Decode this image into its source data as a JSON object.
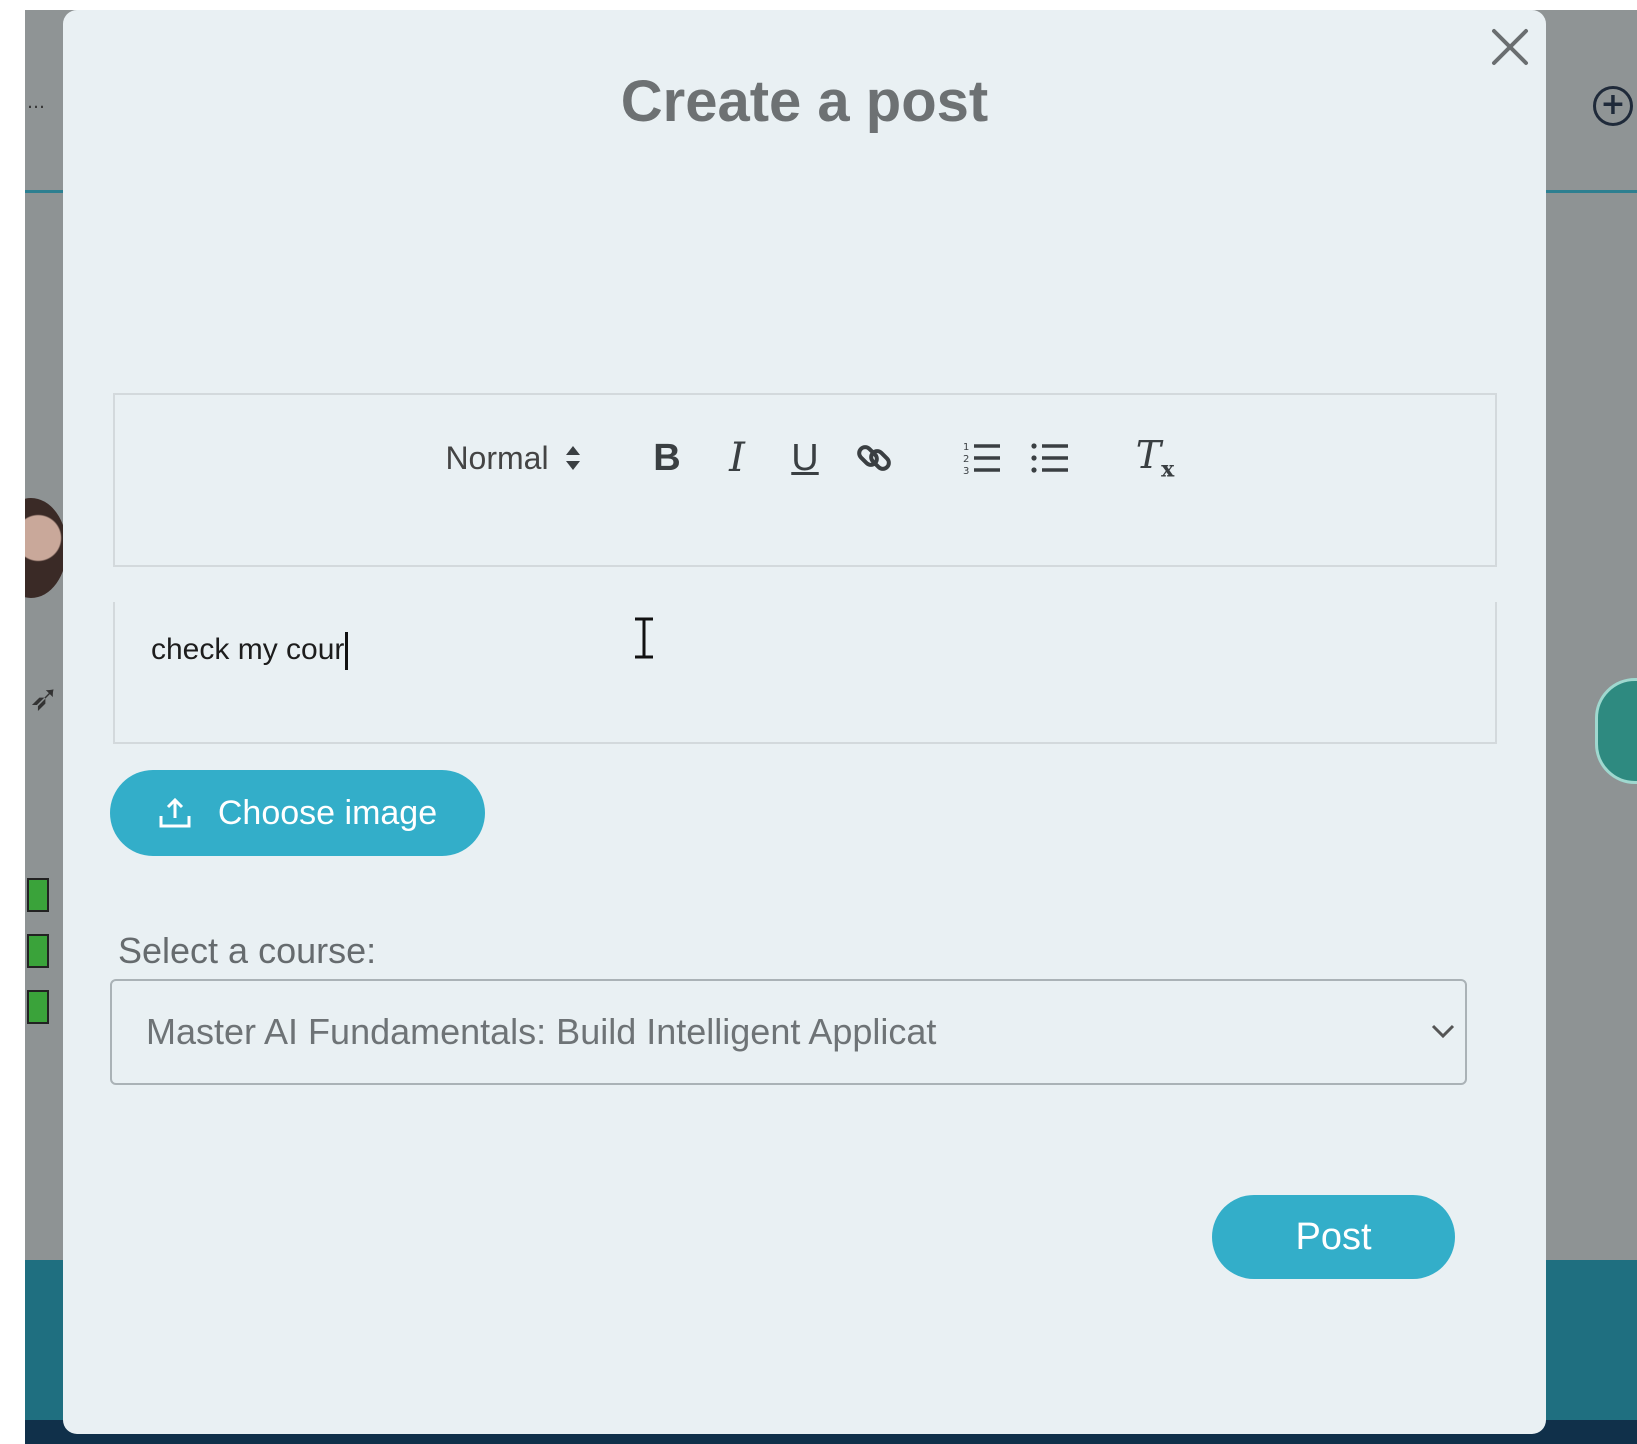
{
  "modal": {
    "title": "Create a post",
    "close_icon": "close-icon"
  },
  "toolbar": {
    "header_select": "Normal",
    "bold": "B",
    "italic": "I",
    "underline": "U",
    "link_icon": "link-icon",
    "ordered_list_icon": "ordered-list-icon",
    "bullet_list_icon": "bullet-list-icon",
    "clean_label": "T",
    "clean_sub": "x"
  },
  "editor": {
    "text": "check my cour"
  },
  "upload": {
    "label": "Choose image",
    "icon": "upload-icon"
  },
  "course": {
    "label": "Select a course:",
    "selected": "Master AI Fundamentals: Build Intelligent Applicat"
  },
  "actions": {
    "post_label": "Post"
  },
  "colors": {
    "accent": "#33aec9",
    "modal_bg": "#e9f0f3",
    "title": "#6d7173"
  }
}
